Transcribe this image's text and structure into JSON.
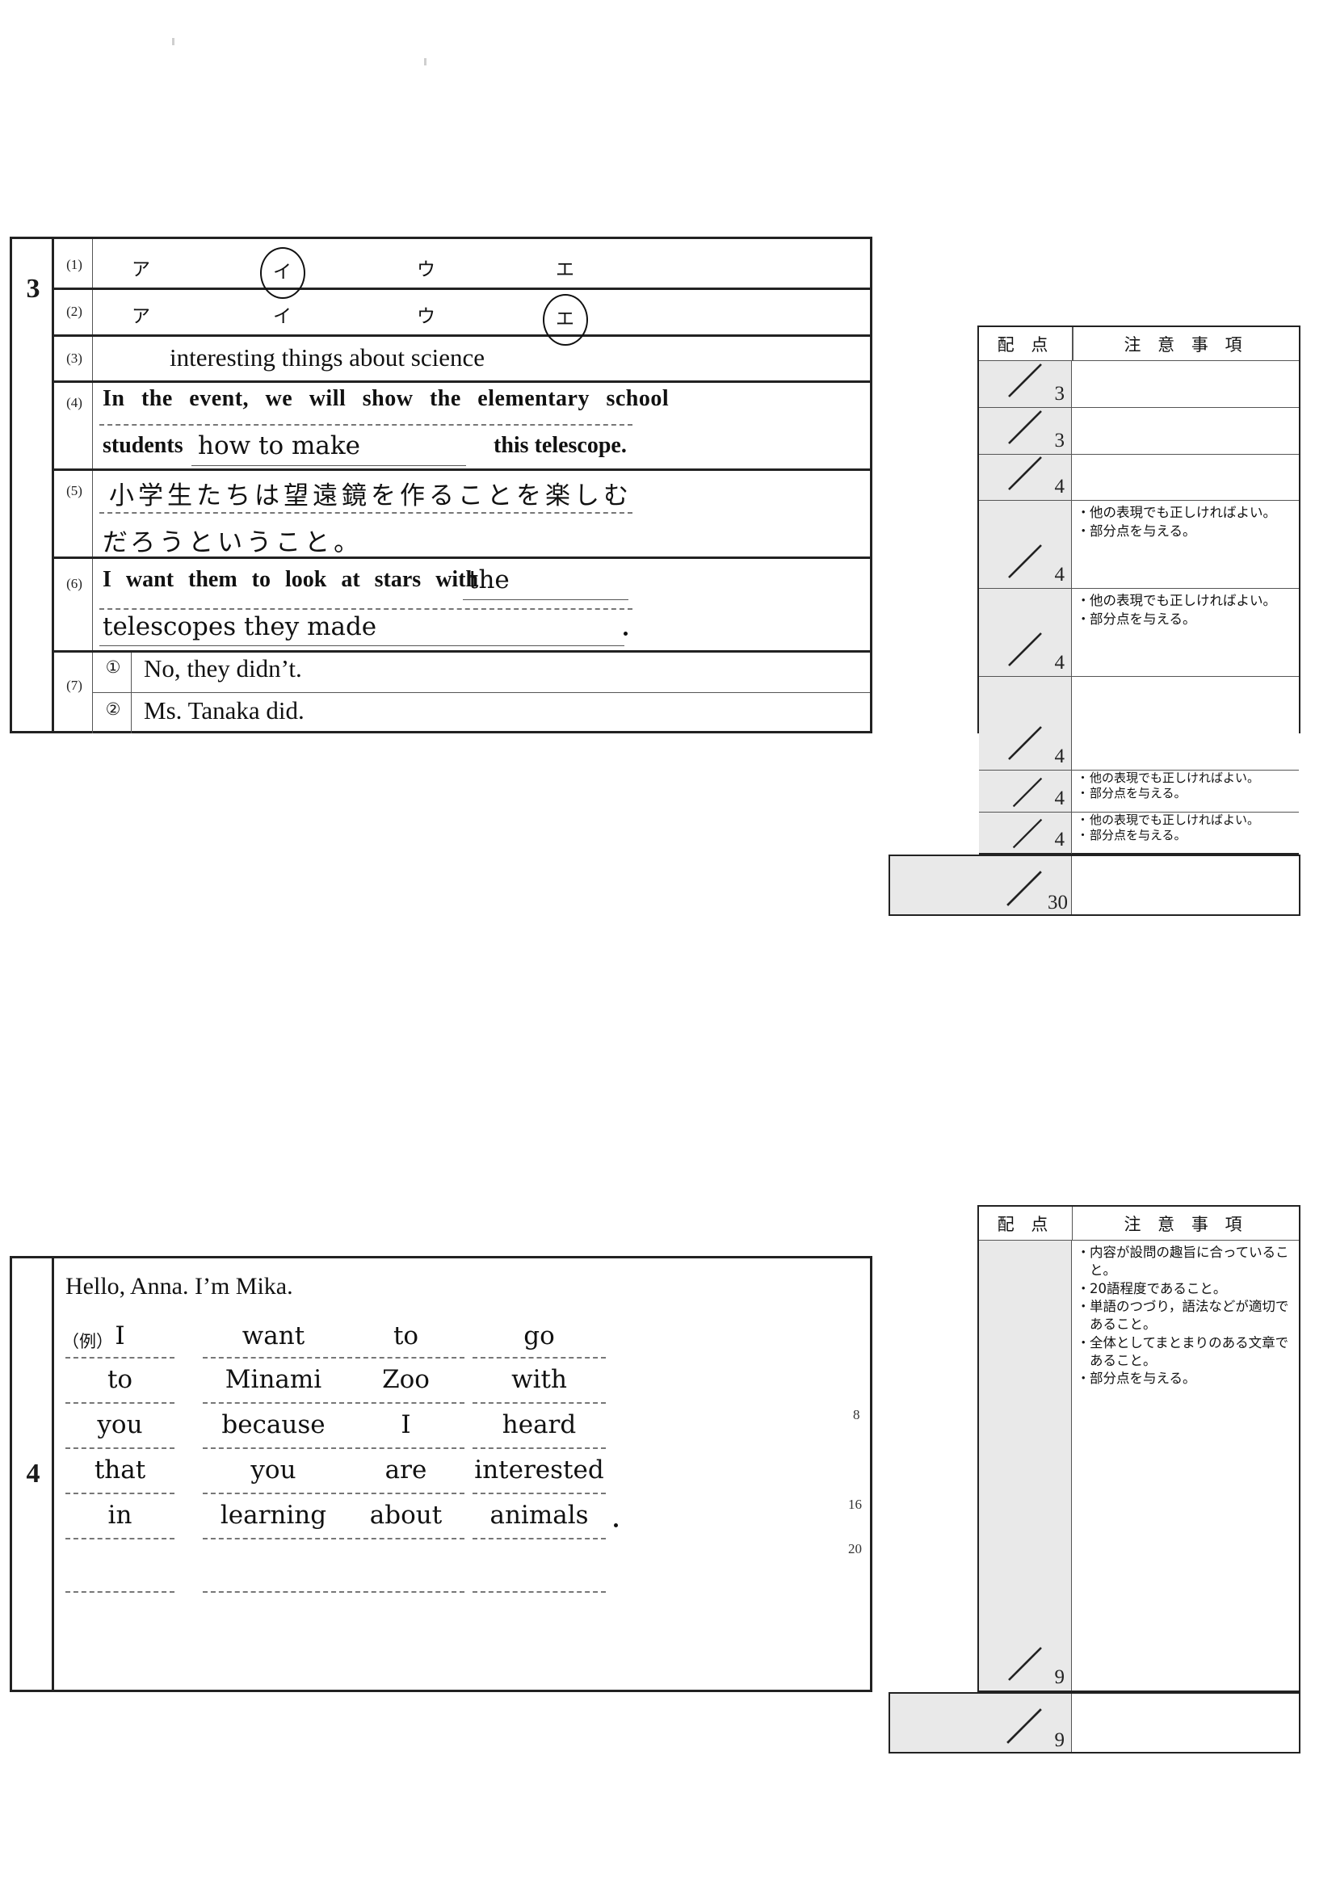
{
  "page": {
    "stray_mark": "·"
  },
  "section3": {
    "number": "3",
    "rows": [
      {
        "label": "(1)",
        "type": "choice",
        "options": [
          "ア",
          "イ",
          "ウ",
          "エ"
        ],
        "selected_index": 1,
        "points": "3",
        "notes": []
      },
      {
        "label": "(2)",
        "type": "choice",
        "options": [
          "ア",
          "イ",
          "ウ",
          "エ"
        ],
        "selected_index": 3,
        "points": "3",
        "notes": []
      },
      {
        "label": "(3)",
        "type": "text",
        "answer": "interesting things about science",
        "points": "4",
        "notes": []
      },
      {
        "label": "(4)",
        "type": "fill",
        "line1_pre": "In the event, we will show the elementary school",
        "line2_pre": "students",
        "line2_fill": "how to make",
        "line2_post": "this telescope.",
        "points": "4",
        "notes": [
          "他の表現でも正しければよい。",
          "部分点を与える。"
        ]
      },
      {
        "label": "(5)",
        "type": "jp",
        "line1": "小学生たちは望遠鏡を作ることを楽しむ",
        "line2": "だろうということ。",
        "points": "4",
        "notes": [
          "他の表現でも正しければよい。",
          "部分点を与える。"
        ]
      },
      {
        "label": "(6)",
        "type": "fill2",
        "line1_pre": "I want them to look at stars with",
        "line1_fill": "the",
        "line2_fill": "telescopes they made",
        "line2_end": ".",
        "points": "4",
        "notes": []
      },
      {
        "label": "(7)",
        "type": "numbered",
        "items": [
          {
            "marker": "①",
            "answer": "No, they didn’t.",
            "points": "4",
            "notes": [
              "他の表現でも正しければよい。",
              "部分点を与える。"
            ]
          },
          {
            "marker": "②",
            "answer": "Ms. Tanaka did.",
            "points": "4",
            "notes": [
              "他の表現でも正しければよい。",
              "部分点を与える。"
            ]
          }
        ]
      }
    ],
    "total_points": "30"
  },
  "section4": {
    "number": "4",
    "greeting": "Hello, Anna.  I’m Mika.",
    "example_label": "（例）",
    "grid": [
      [
        "I",
        "want",
        "to",
        "go"
      ],
      [
        "to",
        "Minami",
        "Zoo",
        "with"
      ],
      [
        "you",
        "because",
        "I",
        "heard"
      ],
      [
        "that",
        "you",
        "are",
        "interested"
      ],
      [
        "in",
        "learning",
        "about",
        "animals"
      ],
      [
        "",
        "",
        "",
        ""
      ]
    ],
    "final_period": ".",
    "word_marks": [
      "8",
      "16",
      "20"
    ],
    "notes": [
      "内容が設問の趣旨に合っていること。",
      "20語程度であること。",
      "単語のつづり，語法などが適切であること。",
      "全体としてまとまりのある文章であること。",
      "部分点を与える。"
    ],
    "points": "9",
    "total_points": "9"
  },
  "score_table": {
    "header_points": "配 点",
    "header_notes": "注 意 事 項"
  }
}
